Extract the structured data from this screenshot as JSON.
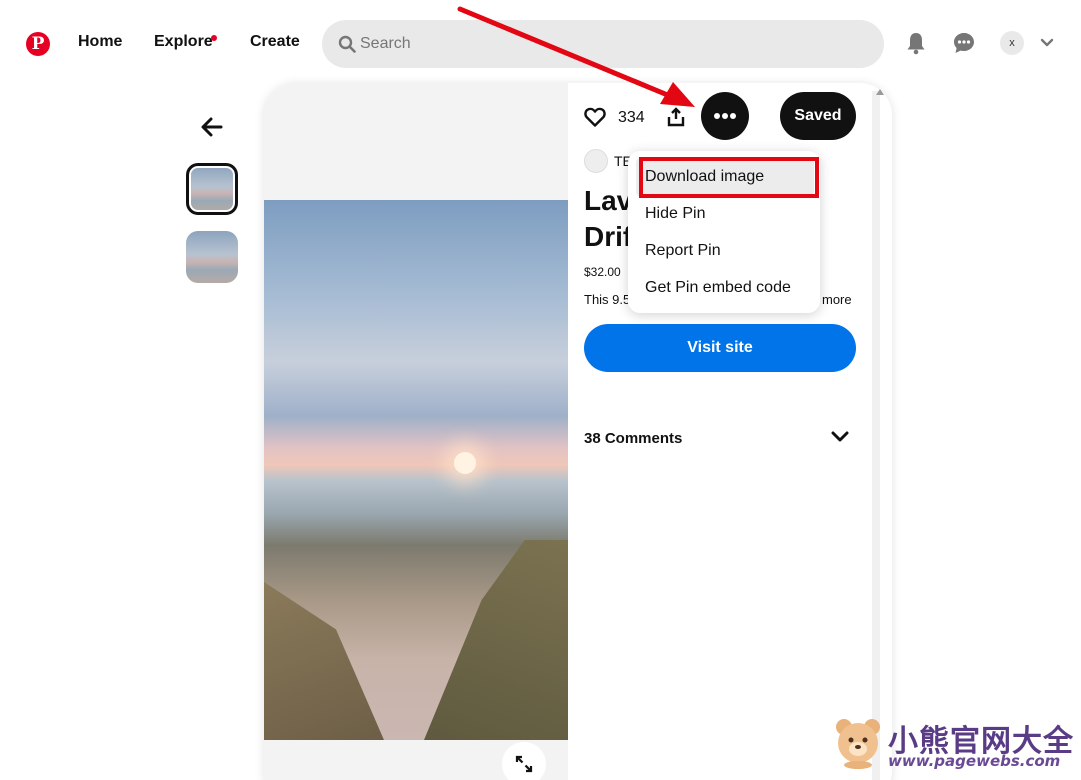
{
  "header": {
    "logo_glyph": "P",
    "nav": [
      "Home",
      "Explore",
      "Create"
    ],
    "search_placeholder": "Search",
    "avatar_initial": "x"
  },
  "pin": {
    "like_count": "334",
    "saved_label": "Saved",
    "source_name": "TE",
    "title_lines": [
      "Lav",
      "Drif"
    ],
    "price": "$32.00",
    "description": "This 9.5",
    "more_label": "more",
    "visit_label": "Visit site",
    "comments_label": "38 Comments"
  },
  "menu": {
    "items": [
      "Download image",
      "Hide Pin",
      "Report Pin",
      "Get Pin embed code"
    ]
  },
  "watermark": {
    "name": "小熊官网大全",
    "url": "www.pagewebs.com"
  },
  "colors": {
    "brand": "#e60023",
    "visit_button": "#0074e8",
    "annotation": "#e30613"
  }
}
